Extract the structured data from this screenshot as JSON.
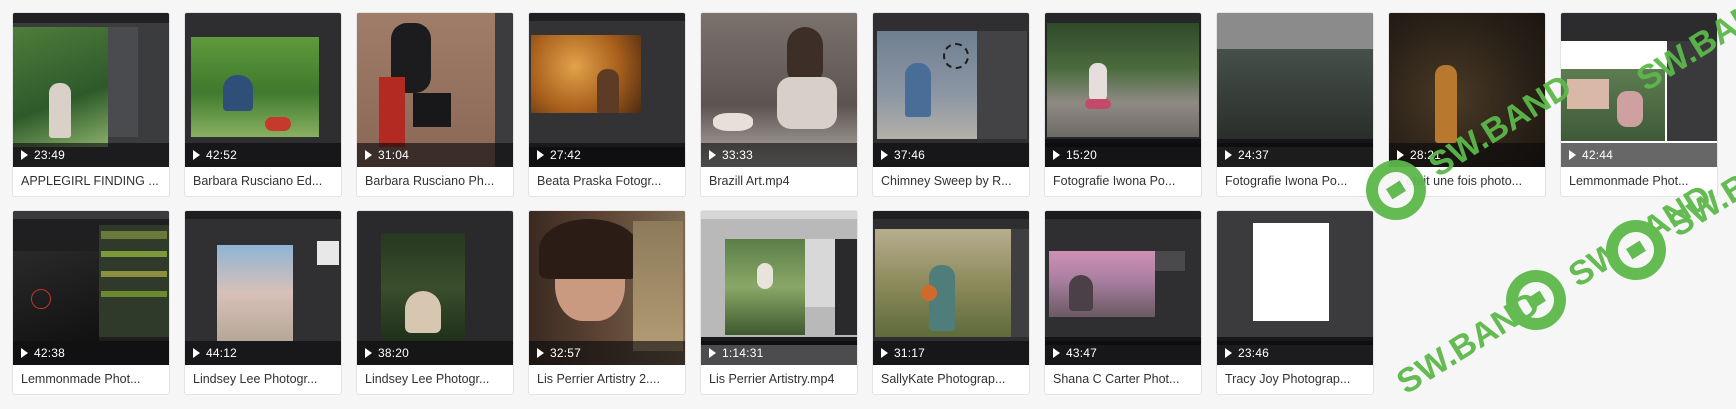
{
  "gallery": {
    "items": [
      {
        "duration": "23:49",
        "name": "APPLEGIRL FINDING ..."
      },
      {
        "duration": "42:52",
        "name": "Barbara Rusciano Ed..."
      },
      {
        "duration": "31:04",
        "name": "Barbara Rusciano Ph..."
      },
      {
        "duration": "27:42",
        "name": "Beata Praska Fotogr..."
      },
      {
        "duration": "33:33",
        "name": "Brazill Art.mp4"
      },
      {
        "duration": "37:46",
        "name": "Chimney Sweep by R..."
      },
      {
        "duration": "15:20",
        "name": "Fotografie Iwona Po..."
      },
      {
        "duration": "24:37",
        "name": "Fotografie Iwona Po..."
      },
      {
        "duration": "28:21",
        "name": "il etait une fois photo..."
      },
      {
        "duration": "42:44",
        "name": "Lemmonmade Phot..."
      },
      {
        "duration": "42:38",
        "name": "Lemmonmade Phot..."
      },
      {
        "duration": "44:12",
        "name": "Lindsey Lee Photogr..."
      },
      {
        "duration": "38:20",
        "name": "Lindsey Lee Photogr..."
      },
      {
        "duration": "32:57",
        "name": "Lis Perrier Artistry 2...."
      },
      {
        "duration": "1:14:31",
        "name": "Lis Perrier Artistry.mp4"
      },
      {
        "duration": "31:17",
        "name": "SallyKate Photograp..."
      },
      {
        "duration": "43:47",
        "name": "Shana C Carter Phot..."
      },
      {
        "duration": "23:46",
        "name": "Tracy Joy Photograp..."
      }
    ]
  },
  "watermark": {
    "text": "SW.BAND",
    "color": "#5db84a"
  }
}
